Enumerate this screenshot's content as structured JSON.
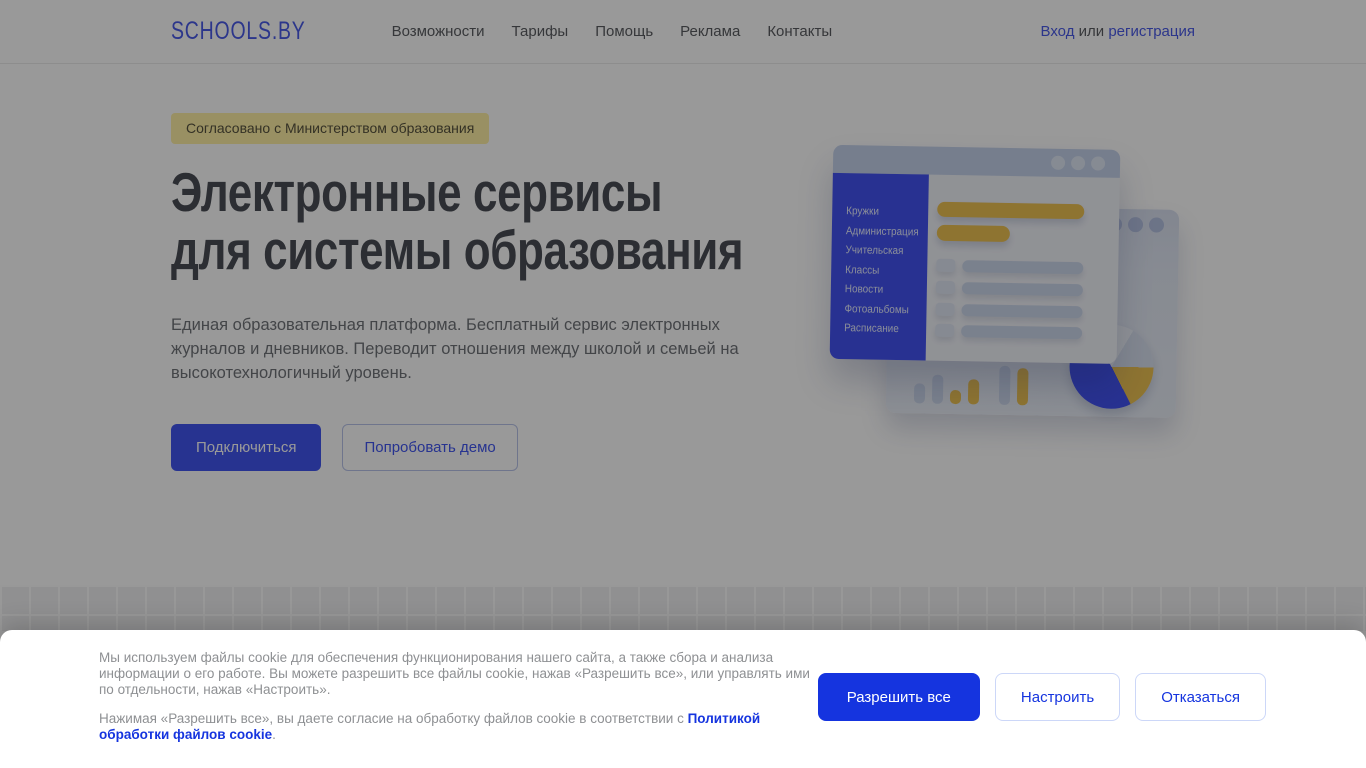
{
  "brand": {
    "logo": "SCHOOLS.BY"
  },
  "nav": {
    "items": [
      "Возможности",
      "Тарифы",
      "Помощь",
      "Реклама",
      "Контакты"
    ],
    "auth": {
      "login": "Вход",
      "or": "или",
      "register": "регистрация"
    }
  },
  "hero": {
    "badge": "Согласовано с Министерством образования",
    "title_line1": "Электронные сервисы",
    "title_line2": "для системы образования",
    "description": "Единая образовательная платформа. Бесплатный сервис электронных журналов и дневников. Переводит отношения между школой и семьей на высокотехнологичный уровень.",
    "primary_button": "Подключиться",
    "secondary_button": "Попробовать демо"
  },
  "illustration": {
    "sidebar_items": [
      "Кружки",
      "Администрация",
      "Учительская",
      "Классы",
      "Новости",
      "Фотоальбомы",
      "Расписание"
    ]
  },
  "cookie_banner": {
    "paragraph1": "Мы используем файлы cookie для обеспечения функционирования нашего сайта, а также сбора и анализа информации о его работе. Вы можете разрешить все файлы cookie, нажав «Разрешить все», или управлять ими по отдельности, нажав «Настроить».",
    "paragraph2_prefix": "Нажимая «Разрешить все», вы даете согласие на обработку файлов cookie в соответствии с ",
    "policy_link": "Политикой обработки файлов cookie",
    "paragraph2_suffix": ".",
    "buttons": {
      "allow_all": "Разрешить все",
      "configure": "Настроить",
      "decline": "Отказаться"
    }
  },
  "colors": {
    "brand": "#4a5ae8",
    "nav_text": "#5a5d61",
    "heading": "#4a4e55",
    "body_text": "#707379",
    "badge_bg": "#fff0a6",
    "badge_text": "#57533e",
    "primary_button": "#4156f0",
    "button_outline_border": "#b9c4ea",
    "illus_sidebar": "#4353f2",
    "illus_yellow": "#edc253",
    "illus_card_front": "#f1f3f9",
    "illus_card_back": "#e2e8f4",
    "illus_topbar": "#c5d2ec",
    "illus_light_bar": "#ccd7ec",
    "cookie_text": "#8e9093",
    "cookie_blue": "#1534df",
    "cookie_outline_border": "#ccd7f8",
    "overlay": "rgba(0,0,0,0.40)"
  }
}
